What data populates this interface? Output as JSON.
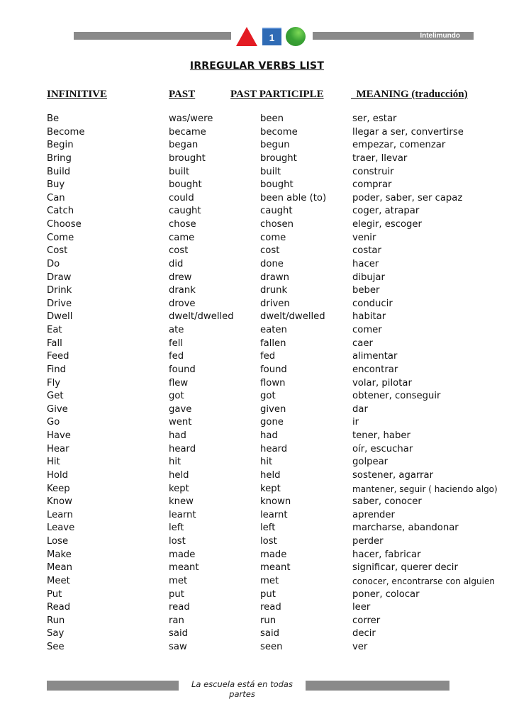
{
  "header": {
    "brand": "Intelimundo",
    "logo_number": "1",
    "logo_icons": [
      "red-triangle-icon",
      "blue-square-icon",
      "green-circle-icon"
    ]
  },
  "title": "IRREGULAR VERBS LIST",
  "columns": {
    "infinitive": "INFINITIVE",
    "past": "PAST",
    "past_participle": "PAST PARTICIPLE",
    "meaning": "  MEANING (traducción)"
  },
  "verbs": [
    {
      "infinitive": "Be",
      "past": "was/were",
      "past_participle": "been",
      "meaning": "ser, estar"
    },
    {
      "infinitive": "Become",
      "past": "became",
      "past_participle": "become",
      "meaning": "llegar a ser, convertirse"
    },
    {
      "infinitive": "Begin",
      "past": "began",
      "past_participle": "begun",
      "meaning": "empezar, comenzar"
    },
    {
      "infinitive": "Bring",
      "past": "brought",
      "past_participle": "brought",
      "meaning": "traer, llevar"
    },
    {
      "infinitive": "Build",
      "past": "built",
      "past_participle": "built",
      "meaning": "construir"
    },
    {
      "infinitive": "Buy",
      "past": "bought",
      "past_participle": "bought",
      "meaning": "comprar"
    },
    {
      "infinitive": "Can",
      "past": "could",
      "past_participle": "been able (to)",
      "meaning": "poder, saber, ser capaz"
    },
    {
      "infinitive": "Catch",
      "past": "caught",
      "past_participle": "caught",
      "meaning": "coger, atrapar"
    },
    {
      "infinitive": "Choose",
      "past": "chose",
      "past_participle": "chosen",
      "meaning": "elegir, escoger"
    },
    {
      "infinitive": "Come",
      "past": "came",
      "past_participle": "come",
      "meaning": "venir"
    },
    {
      "infinitive": "Cost",
      "past": "cost",
      "past_participle": "cost",
      "meaning": "costar"
    },
    {
      "infinitive": "Do",
      "past": "did",
      "past_participle": "done",
      "meaning": "hacer"
    },
    {
      "infinitive": "Draw",
      "past": "drew",
      "past_participle": "drawn",
      "meaning": "dibujar"
    },
    {
      "infinitive": "Drink",
      "past": "drank",
      "past_participle": "drunk",
      "meaning": "beber"
    },
    {
      "infinitive": "Drive",
      "past": "drove",
      "past_participle": "driven",
      "meaning": "conducir"
    },
    {
      "infinitive": "Dwell",
      "past": "dwelt/dwelled",
      "past_participle": "dwelt/dwelled",
      "meaning": "habitar"
    },
    {
      "infinitive": "Eat",
      "past": "ate",
      "past_participle": "eaten",
      "meaning": "comer"
    },
    {
      "infinitive": "Fall",
      "past": "fell",
      "past_participle": "fallen",
      "meaning": "caer"
    },
    {
      "infinitive": "Feed",
      "past": "fed",
      "past_participle": "fed",
      "meaning": "alimentar"
    },
    {
      "infinitive": "Find",
      "past": "found",
      "past_participle": "found",
      "meaning": "encontrar"
    },
    {
      "infinitive": "Fly",
      "past": "flew",
      "past_participle": "flown",
      "meaning": "volar, pilotar"
    },
    {
      "infinitive": "Get",
      "past": "got",
      "past_participle": "got",
      "meaning": "obtener, conseguir"
    },
    {
      "infinitive": "Give",
      "past": "gave",
      "past_participle": "given",
      "meaning": "dar"
    },
    {
      "infinitive": "Go",
      "past": "went",
      "past_participle": "gone",
      "meaning": "ir"
    },
    {
      "infinitive": "Have",
      "past": "had",
      "past_participle": "had",
      "meaning": "tener, haber"
    },
    {
      "infinitive": "Hear",
      "past": "heard",
      "past_participle": "heard",
      "meaning": "oír, escuchar"
    },
    {
      "infinitive": "Hit",
      "past": "hit",
      "past_participle": "hit",
      "meaning": "golpear"
    },
    {
      "infinitive": "Hold",
      "past": "held",
      "past_participle": "held",
      "meaning": "sostener, agarrar"
    },
    {
      "infinitive": "Keep",
      "past": "kept",
      "past_participle": "kept",
      "meaning": "mantener, seguir ( haciendo algo)"
    },
    {
      "infinitive": "Know",
      "past": "knew",
      "past_participle": "known",
      "meaning": "saber, conocer"
    },
    {
      "infinitive": "Learn",
      "past": "learnt",
      "past_participle": "learnt",
      "meaning": "aprender"
    },
    {
      "infinitive": "Leave",
      "past": "left",
      "past_participle": "left",
      "meaning": "marcharse, abandonar"
    },
    {
      "infinitive": "Lose",
      "past": "lost",
      "past_participle": "lost",
      "meaning": "perder"
    },
    {
      "infinitive": "Make",
      "past": "made",
      "past_participle": "made",
      "meaning": "hacer, fabricar"
    },
    {
      "infinitive": "Mean",
      "past": "meant",
      "past_participle": "meant",
      "meaning": "significar, querer decir"
    },
    {
      "infinitive": "Meet",
      "past": "met",
      "past_participle": "met",
      "meaning": "conocer, encontrarse con alguien"
    },
    {
      "infinitive": "Put",
      "past": "put",
      "past_participle": "put",
      "meaning": "poner, colocar"
    },
    {
      "infinitive": "Read",
      "past": "read",
      "past_participle": "read",
      "meaning": "leer"
    },
    {
      "infinitive": "Run",
      "past": "ran",
      "past_participle": "run",
      "meaning": "correr"
    },
    {
      "infinitive": "Say",
      "past": "said",
      "past_participle": "said",
      "meaning": "decir"
    },
    {
      "infinitive": "See",
      "past": "saw",
      "past_participle": "seen",
      "meaning": "ver"
    }
  ],
  "footer": {
    "tagline": "La escuela está en todas partes"
  }
}
